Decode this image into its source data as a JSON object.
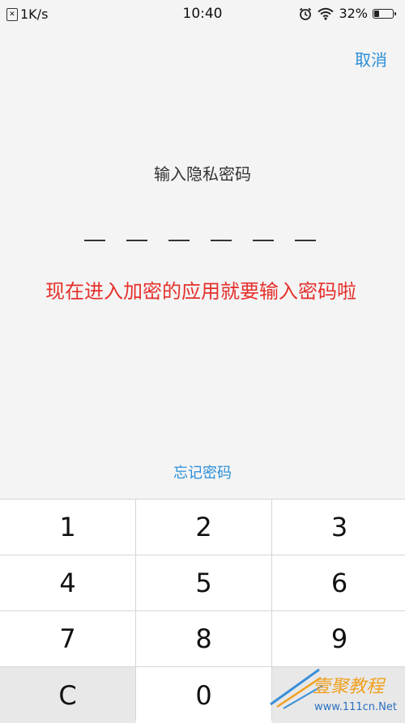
{
  "status_bar": {
    "net_speed": "1K/s",
    "time": "10:40",
    "battery_percent": "32%",
    "battery_level": 0.32,
    "icons": [
      "network-speed-icon",
      "alarm-icon",
      "wifi-icon",
      "battery-icon"
    ]
  },
  "header": {
    "cancel_label": "取消"
  },
  "prompt": {
    "title": "输入隐私密码",
    "pin_length": 6,
    "entered": 0
  },
  "annotation": {
    "text": "现在进入加密的应用就要输入密码啦",
    "color": "#e5302c"
  },
  "forgot": {
    "label": "忘记密码"
  },
  "keypad": {
    "keys": [
      "1",
      "2",
      "3",
      "4",
      "5",
      "6",
      "7",
      "8",
      "9",
      "C",
      "0",
      ""
    ]
  },
  "watermark": {
    "brand": "壹聚教程",
    "url": "www.111cn.Net"
  },
  "colors": {
    "accent": "#2a8fd8",
    "background": "#f4f4f4"
  }
}
